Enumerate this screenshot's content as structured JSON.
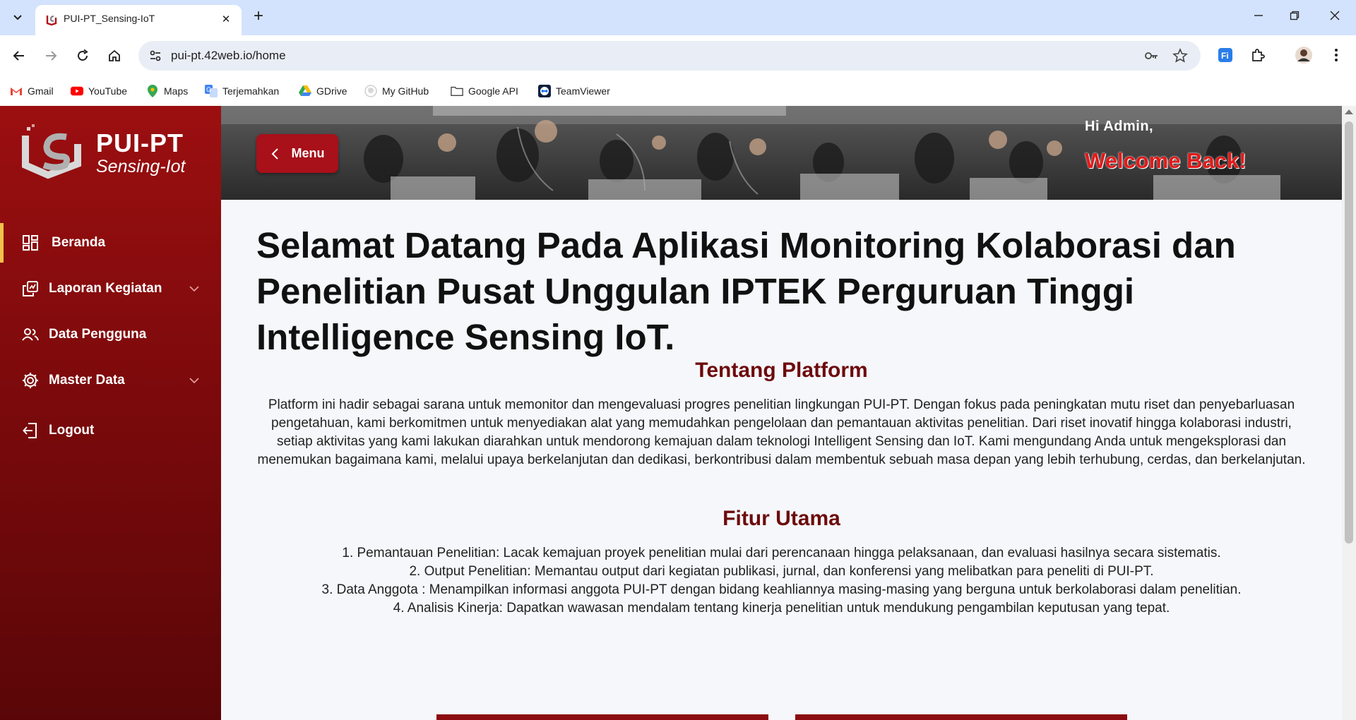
{
  "browser": {
    "tab_title": "PUI-PT_Sensing-IoT",
    "url": "pui-pt.42web.io/home",
    "new_tab_symbol": "+",
    "close_symbol": "✕",
    "bookmarks": [
      {
        "label": "Gmail",
        "icon": "gmail-icon"
      },
      {
        "label": "YouTube",
        "icon": "youtube-icon"
      },
      {
        "label": "Maps",
        "icon": "maps-icon"
      },
      {
        "label": "Terjemahkan",
        "icon": "translate-icon"
      },
      {
        "label": "GDrive",
        "icon": "drive-icon"
      },
      {
        "label": "My GitHub",
        "icon": "github-icon"
      },
      {
        "label": "Google API",
        "icon": "folder-icon"
      },
      {
        "label": "TeamViewer",
        "icon": "teamviewer-icon"
      }
    ]
  },
  "sidebar": {
    "logo_title": "PUI-PT",
    "logo_subtitle": "Sensing-Iot",
    "items": [
      {
        "label": "Beranda",
        "icon": "dashboard-icon",
        "active": true
      },
      {
        "label": "Laporan Kegiatan",
        "icon": "report-icon",
        "has_submenu": true
      },
      {
        "label": "Data Pengguna",
        "icon": "users-icon"
      },
      {
        "label": "Master Data",
        "icon": "gear-icon",
        "has_submenu": true
      },
      {
        "label": "Logout",
        "icon": "logout-icon"
      }
    ]
  },
  "header": {
    "menu_label": "Menu",
    "greeting": "Hi Admin,",
    "welcome": "Welcome Back!"
  },
  "main": {
    "headline_bold": "Selamat Datang Pada",
    "headline_rest": " Aplikasi Monitoring Kolaborasi dan Penelitian Pusat Unggulan IPTEK Perguruan Tinggi Intelligence Sensing IoT.",
    "about_title": "Tentang Platform",
    "about_text": "Platform ini hadir sebagai sarana untuk memonitor dan mengevaluasi progres penelitian lingkungan PUI-PT. Dengan fokus pada peningkatan mutu riset dan penyebarluasan pengetahuan, kami berkomitmen untuk menyediakan alat yang memudahkan pengelolaan dan pemantauan aktivitas penelitian. Dari riset inovatif hingga kolaborasi industri, setiap aktivitas yang kami lakukan diarahkan untuk mendorong kemajuan dalam teknologi Intelligent Sensing dan IoT. Kami mengundang Anda untuk mengeksplorasi dan menemukan bagaimana kami, melalui upaya berkelanjutan dan dedikasi, berkontribusi dalam membentuk sebuah masa depan yang lebih terhubung, cerdas, dan berkelanjutan.",
    "features_title": "Fitur Utama",
    "features": [
      "1. Pemantauan Penelitian: Lacak kemajuan proyek penelitian mulai dari perencanaan hingga pelaksanaan, dan evaluasi hasilnya secara sistematis.",
      "2. Output Penelitian: Memantau output dari kegiatan publikasi, jurnal, dan konferensi yang melibatkan para peneliti di PUI-PT.",
      "3. Data Anggota : Menampilkan informasi anggota PUI-PT dengan bidang keahliannya masing-masing yang berguna untuk berkolaborasi dalam penelitian.",
      "4. Analisis Kinerja: Dapatkan wawasan mendalam tentang kinerja penelitian untuk mendukung pengambilan keputusan yang tepat."
    ]
  },
  "colors": {
    "sidebar": "#8b0c10",
    "accent": "#6d0b0d",
    "active_bar": "#f3c24b",
    "welcome": "#e21a1a"
  }
}
